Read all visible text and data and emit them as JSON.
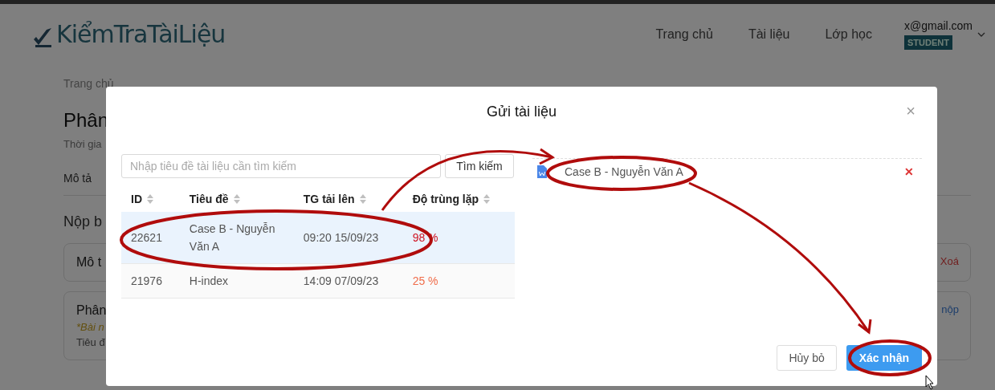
{
  "header": {
    "logo": "KiểmTraTàiLiệu",
    "nav": [
      "Trang chủ",
      "Tài liệu",
      "Lớp học"
    ],
    "user": {
      "email": "x@gmail.com",
      "role": "STUDENT"
    }
  },
  "page": {
    "breadcrumb": [
      "Trang chủ"
    ],
    "title": "Phân",
    "subtitle": "Thời gia",
    "tab": "Mô tả",
    "section": "Nộp b",
    "cards": [
      {
        "title": "Mô t",
        "action": "Xoá",
        "kind": "delete"
      },
      {
        "title": "Phân",
        "note": "*Bài n",
        "line": "Tiêu đ",
        "action": "nộp",
        "kind": "link"
      }
    ]
  },
  "modal": {
    "title": "Gửi tài liệu",
    "close": "×",
    "search": {
      "placeholder": "Nhập tiêu đề tài liệu cần tìm kiếm",
      "button": "Tìm kiếm"
    },
    "table": {
      "columns": [
        "ID",
        "Tiêu đề",
        "TG tải lên",
        "Độ trùng lặp"
      ],
      "rows": [
        {
          "id": "22621",
          "title": "Case B - Nguyễn Văn A",
          "uploaded": "09:20 15/09/23",
          "similarity": "98 %",
          "color": "#cf1322",
          "selected": true
        },
        {
          "id": "21976",
          "title": "H-index",
          "uploaded": "14:09 07/09/23",
          "similarity": "25 %",
          "color": "#f06d4b",
          "selected": false
        }
      ]
    },
    "selected_files": [
      {
        "name": "Case B - Nguyễn Văn A",
        "remove": "✕"
      }
    ],
    "buttons": {
      "cancel": "Hủy bỏ",
      "confirm": "Xác nhận"
    }
  }
}
